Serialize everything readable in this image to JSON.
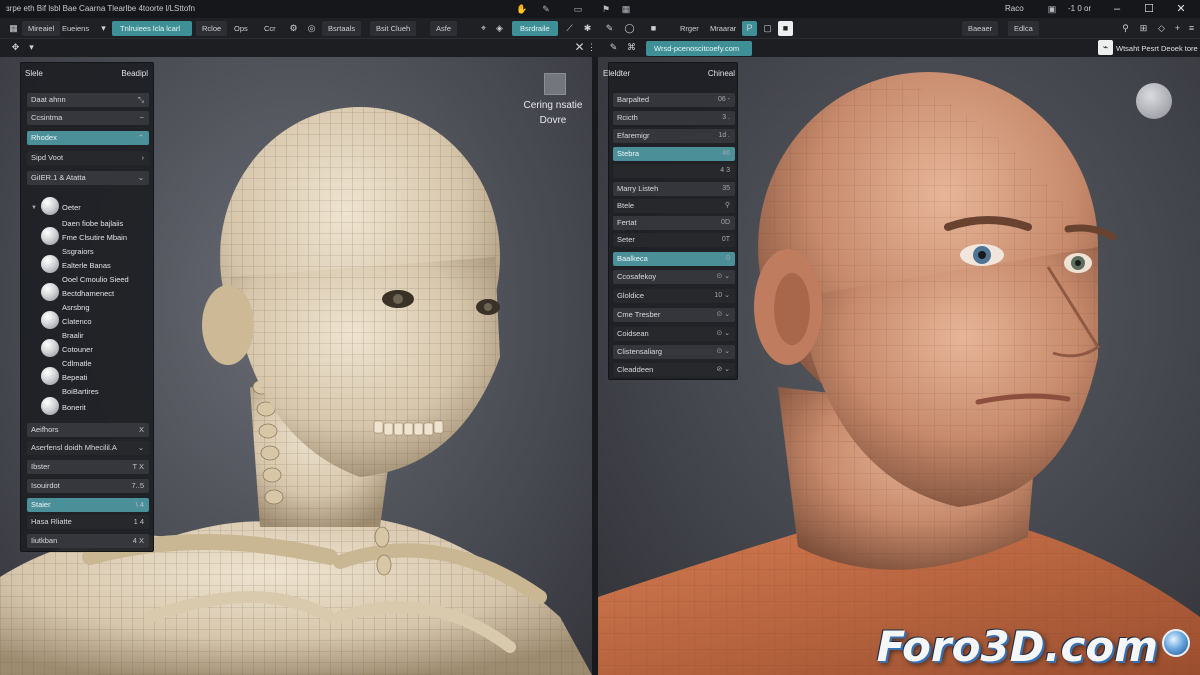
{
  "titlebar": {
    "title": "ɜrpe eth Bif lsbl Bae Caarna Tlearlbe 4toorte l/LSttofn",
    "right_label": "Raco",
    "right_value": "-1 0 or",
    "icons": [
      "hand-icon",
      "pen-icon",
      "monitor-icon",
      "flag-icon",
      "grid-icon"
    ]
  },
  "toolbar": {
    "left_items": [
      "Mireaiel",
      "Eueiens",
      "Rcloe",
      "Ops",
      "Ccr",
      "Bsrtaals",
      "Bsit Clueh",
      "Asfe"
    ],
    "teal_item_1": "Tnlruiees lcla lcarl",
    "teal_item_2": "Bsrdraile",
    "right_items": [
      "Rrger",
      "Mraarar"
    ],
    "far_right": [
      "Baeaer",
      "Edlca"
    ]
  },
  "subbar": {
    "right_tab": "Wrsd-pcenoscitcoefy.com",
    "far_right_text": "Wtsaht Pesrt Deoek tore Reaet 1tolth"
  },
  "left_panel": {
    "header_left": "Slele",
    "header_right": "Beadipl",
    "rows": [
      {
        "label": "Daat ahnn",
        "right": "⤡"
      },
      {
        "label": "Ccsintma",
        "right": "~"
      },
      {
        "label": "Rhodex",
        "right": "⌃"
      },
      {
        "label": "Sipd Voot",
        "right": "›"
      },
      {
        "label": "GiIER.1 & Atatta",
        "right": "⌄"
      }
    ],
    "materials": [
      "Oeter",
      "Daen fiobe bajlaiis",
      "Fme Clsutire Mbain",
      "Ssgraiors",
      "Ealterle Banas",
      "Ooel Cmoulio Sieed",
      "Bectdhamenect",
      "Asrsbng",
      "Clatenco",
      "Braalir",
      "Cotouner",
      "Cdlmatle",
      "Bepeati",
      "BoiBartires",
      "Bonerit"
    ],
    "bottom_rows": [
      {
        "label": "Aeifhors",
        "right": "X"
      },
      {
        "label": "Aserfensl doidh Mhecilil.A",
        "right": "⌄"
      },
      {
        "label": "Ibster",
        "right": "T X"
      },
      {
        "label": "Isouirdot",
        "right": "7..5"
      },
      {
        "label": "Staier",
        "right": "\\ 4"
      },
      {
        "label": "Hasa Rliatte",
        "right": "1 4"
      },
      {
        "label": "Iiutkban",
        "right": "4 X"
      }
    ]
  },
  "viewport_left": {
    "overlay_line1": "Cering nsatie",
    "overlay_line2": "Dovre"
  },
  "right_panel": {
    "header_left": "Eleldter",
    "header_right": "Chineal",
    "rows": [
      {
        "label": "Barpalted",
        "right": "06 -"
      },
      {
        "label": "Rcicth",
        "right": "3 ."
      },
      {
        "label": "Efaremigr",
        "right": "1d ."
      },
      {
        "label": "Stebra",
        "right": "46"
      },
      {
        "label": "",
        "right": "4 3"
      },
      {
        "label": "Marry Listeh",
        "right": "35"
      },
      {
        "label": "Btele",
        "right": "⚲"
      },
      {
        "label": "Fertat",
        "right": "0D"
      },
      {
        "label": "Seter",
        "right": "0T"
      },
      {
        "label": "Baalkeca",
        "right": "0"
      },
      {
        "label": "Ccosafekoy",
        "right": "⊙ ⌄"
      },
      {
        "label": "Gloldice",
        "right": "10 ⌄"
      },
      {
        "label": "Cme Tresber",
        "right": "⊙ ⌄"
      },
      {
        "label": "Coidsean",
        "right": "⊙ ⌄"
      },
      {
        "label": "Clistensaliarg",
        "right": "⊙ ⌄"
      },
      {
        "label": "Cleaddeen",
        "right": "⊘ ⌄"
      }
    ]
  },
  "watermark": "Foro3D.com"
}
